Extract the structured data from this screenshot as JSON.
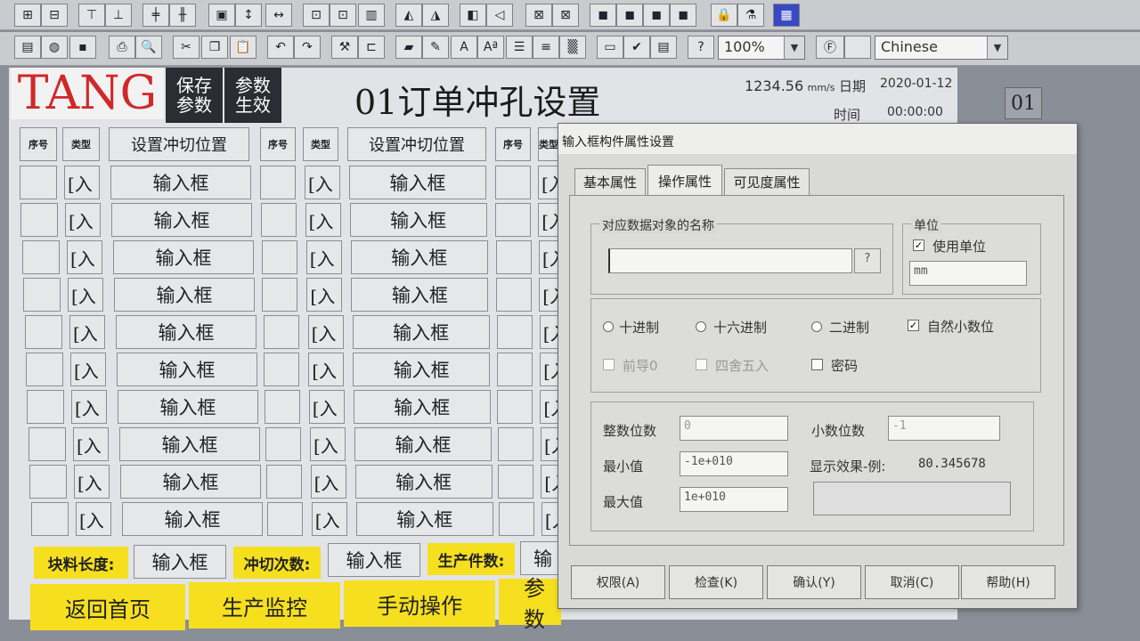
{
  "toolbar": {
    "zoom": "100%",
    "language": "Chinese"
  },
  "screen": {
    "logo": "TANG",
    "save_params": "保存参数",
    "param_apply": "参数生效",
    "title": "01订单冲孔设置",
    "speed": "1234.56",
    "speed_unit": "mm/s",
    "date_label": "日期",
    "date_value": "2020-01-12",
    "time_label": "时间",
    "time_value": "00:00:00",
    "right_badge": "01",
    "col_seq": "序号",
    "col_type": "类型",
    "col_position": "设置冲切位置",
    "input_text": "输入框",
    "type_text": "[入",
    "bottom_labels": {
      "material_length": "块料长度:",
      "punch_count": "冲切次数:",
      "production_count": "生产件数:"
    },
    "bottom_input_short": "输",
    "nav": {
      "home": "返回首页",
      "monitor": "生产监控",
      "manual": "手动操作",
      "params": "参数"
    }
  },
  "dialog": {
    "title": "输入框构件属性设置",
    "tabs": [
      "基本属性",
      "操作属性",
      "可见度属性"
    ],
    "data_object_label": "对应数据对象的名称",
    "data_object_value": "",
    "help_button": "?",
    "unit_group": "单位",
    "use_unit": "使用单位",
    "unit_value": "mm",
    "radios": [
      "十进制",
      "十六进制",
      "二进制"
    ],
    "natural_decimal": "自然小数位",
    "leading_zero": "前导0",
    "rounding": "四舍五入",
    "password": "密码",
    "integer_digits_label": "整数位数",
    "integer_digits_value": "0",
    "decimal_digits_label": "小数位数",
    "decimal_digits_value": "-1",
    "min_label": "最小值",
    "min_value": "-1e+010",
    "max_label": "最大值",
    "max_value": "1e+010",
    "preview_label": "显示效果-例:",
    "preview_value": "80.345678",
    "buttons": [
      "权限(A)",
      "检查(K)",
      "确认(Y)",
      "取消(C)",
      "帮助(H)"
    ]
  }
}
